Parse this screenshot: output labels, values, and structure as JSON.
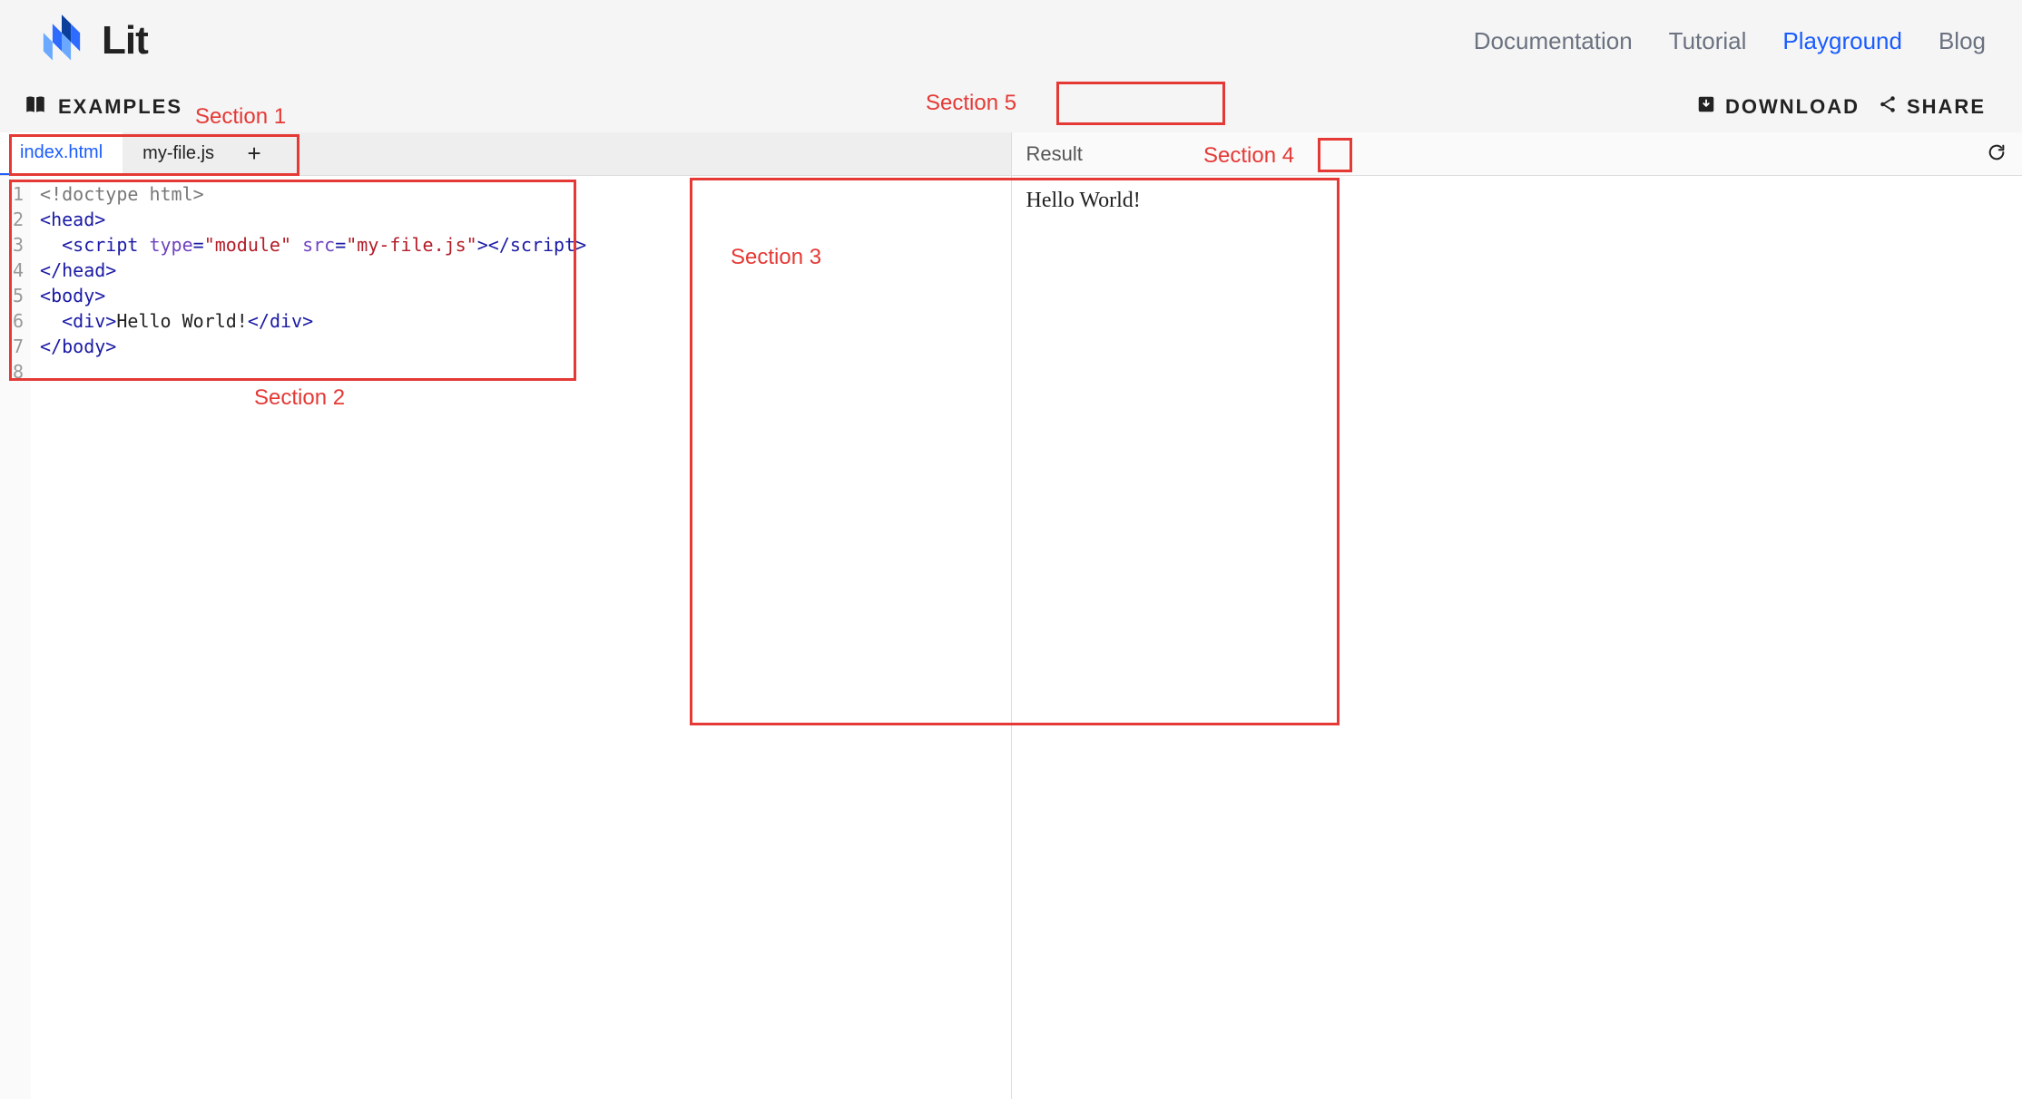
{
  "brand": {
    "name": "Lit"
  },
  "nav": {
    "documentation": "Documentation",
    "tutorial": "Tutorial",
    "playground": "Playground",
    "blog": "Blog",
    "active": "playground"
  },
  "toolbar": {
    "examples_label": "EXAMPLES",
    "download_label": "DOWNLOAD",
    "share_label": "SHARE"
  },
  "annotations": {
    "section1": "Section 1",
    "section2": "Section 2",
    "section3": "Section 3",
    "section4": "Section 4",
    "section5": "Section 5"
  },
  "tabs": {
    "items": [
      {
        "label": "index.html",
        "active": true
      },
      {
        "label": "my-file.js",
        "active": false
      }
    ],
    "add_tooltip": "+"
  },
  "editor": {
    "line_numbers": [
      "1",
      "2",
      "3",
      "4",
      "5",
      "6",
      "7",
      "8"
    ],
    "tokens": [
      [
        {
          "t": "doctype",
          "v": "<!doctype html>"
        }
      ],
      [
        {
          "t": "tag",
          "v": "<head>"
        }
      ],
      [
        {
          "t": "txt",
          "v": "  "
        },
        {
          "t": "tag",
          "v": "<script "
        },
        {
          "t": "attr",
          "v": "type"
        },
        {
          "t": "tag",
          "v": "="
        },
        {
          "t": "str",
          "v": "\"module\""
        },
        {
          "t": "tag",
          "v": " "
        },
        {
          "t": "attr",
          "v": "src"
        },
        {
          "t": "tag",
          "v": "="
        },
        {
          "t": "str",
          "v": "\"my-file.js\""
        },
        {
          "t": "tag",
          "v": "></script>"
        }
      ],
      [
        {
          "t": "tag",
          "v": "</head>"
        }
      ],
      [
        {
          "t": "tag",
          "v": "<body>"
        }
      ],
      [
        {
          "t": "txt",
          "v": "  "
        },
        {
          "t": "tag",
          "v": "<div>"
        },
        {
          "t": "txt",
          "v": "Hello World!"
        },
        {
          "t": "tag",
          "v": "</div>"
        }
      ],
      [
        {
          "t": "tag",
          "v": "</body>"
        }
      ],
      [
        {
          "t": "txt",
          "v": ""
        }
      ]
    ]
  },
  "result": {
    "header_label": "Result",
    "output_text": "Hello World!"
  }
}
